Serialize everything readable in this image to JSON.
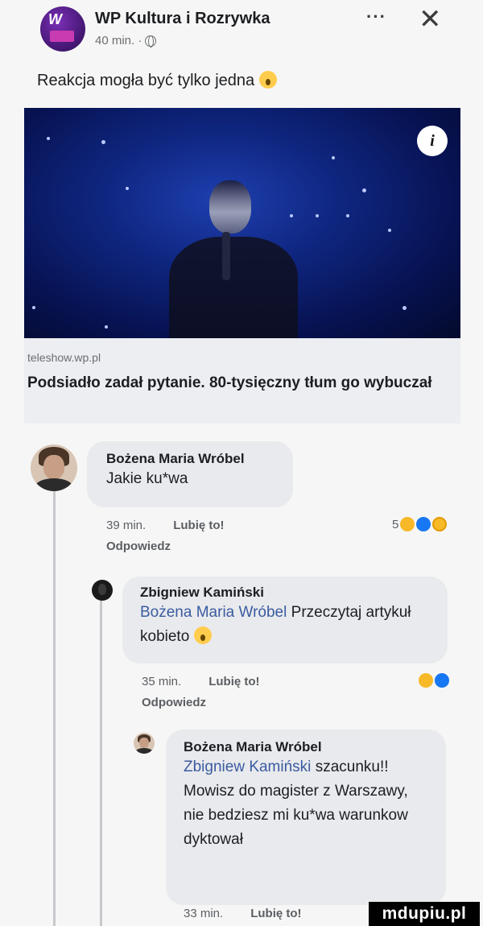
{
  "header": {
    "page_name": "WP Kultura i Rozrywka",
    "timestamp": "40 min.",
    "more_icon": "more-icon",
    "close_icon": "close-icon"
  },
  "post": {
    "text": "Reakcja mogła być tylko jedna"
  },
  "link_preview": {
    "domain": "teleshow.wp.pl",
    "title": "Podsiadło zadał pytanie. 80-tysięczny tłum go wybuczał"
  },
  "comments": [
    {
      "author": "Bożena Maria Wróbel",
      "text": "Jakie ku*wa",
      "time": "39 min.",
      "like_label": "Lubię to!",
      "reply_label": "Odpowiedz",
      "reaction_count": "5"
    },
    {
      "author": "Zbigniew Kamiński",
      "mention": "Bożena Maria Wróbel",
      "text": "Przeczytaj artykuł kobieto",
      "time": "35 min.",
      "like_label": "Lubię to!",
      "reply_label": "Odpowiedz"
    },
    {
      "author": "Bożena Maria Wróbel",
      "mention": "Zbigniew Kamiński",
      "text": "szacunku!! Mowisz do magister z Warszawy, nie bedziesz mi ku*wa warunkow dyktował",
      "time": "33 min.",
      "like_label": "Lubię to!"
    }
  ],
  "watermark": "mdupiu.pl",
  "colors": {
    "background": "#f6f6f6",
    "bubble": "#e9eaed",
    "mention": "#3a5ba0",
    "page_avatar": "#4a1a7a"
  }
}
